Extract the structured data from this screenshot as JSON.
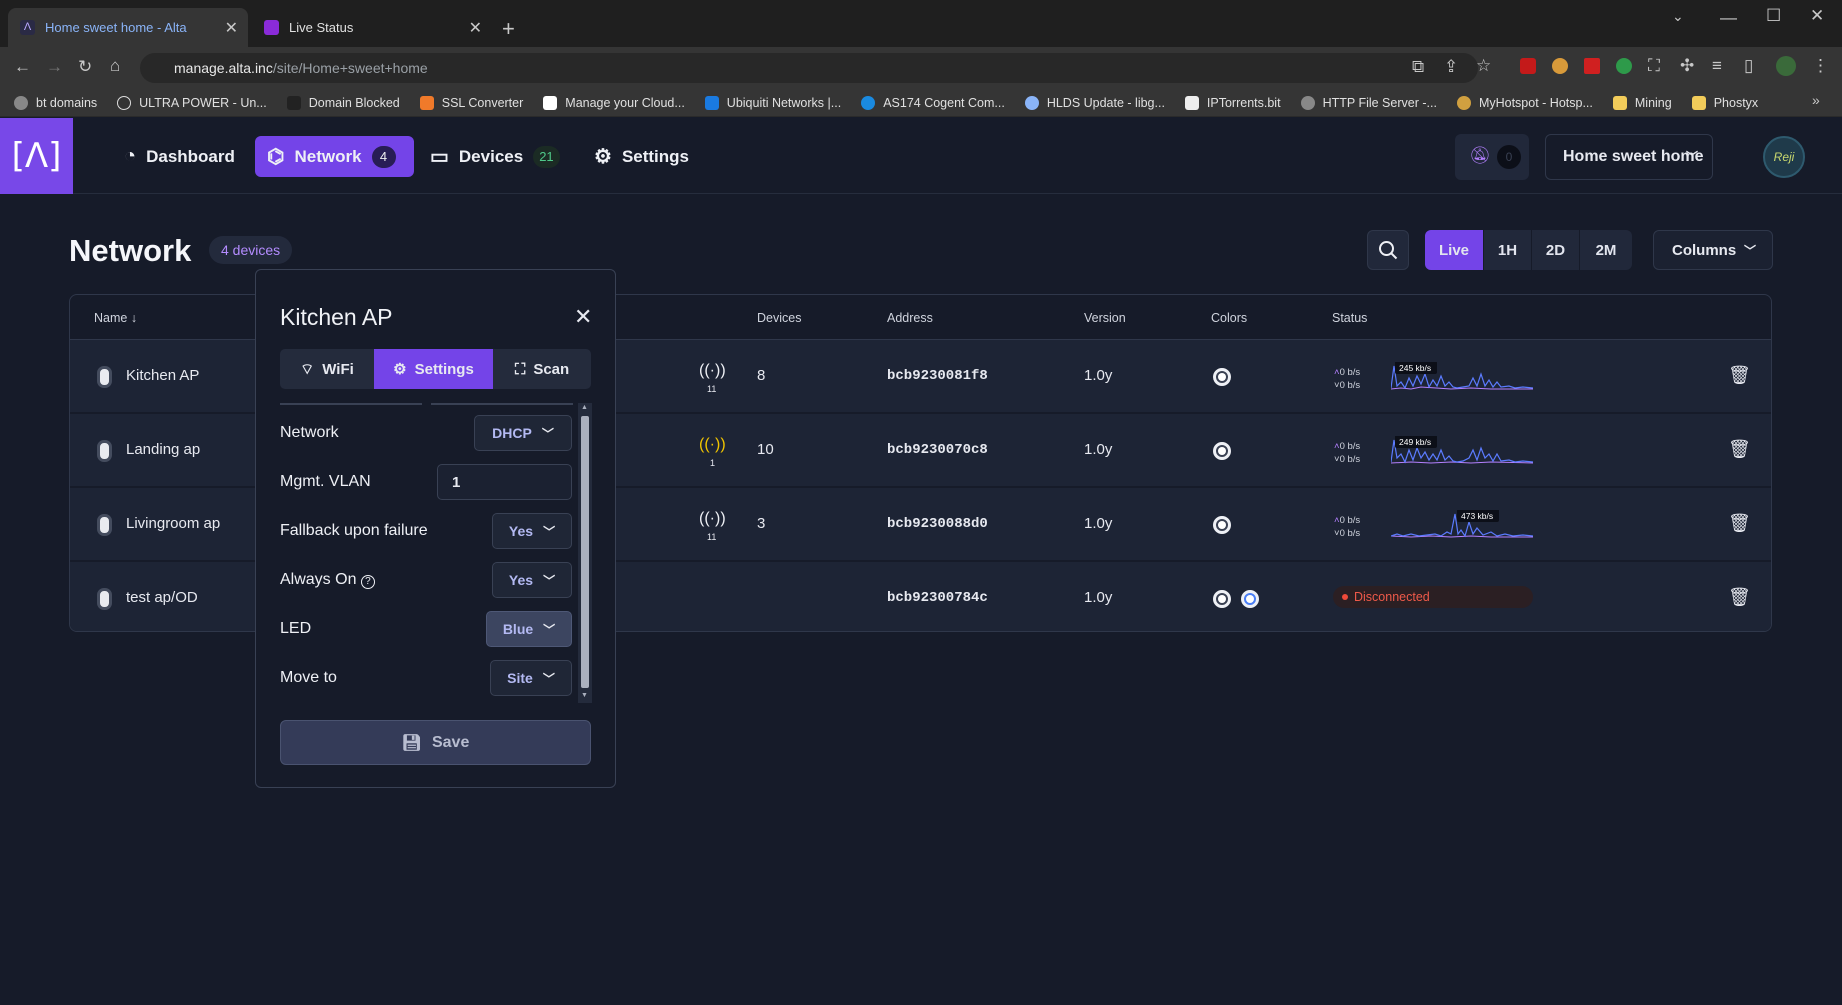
{
  "browser": {
    "tabs": [
      {
        "title": "Home sweet home - Alta",
        "active": true
      },
      {
        "title": "Live Status",
        "active": false
      }
    ],
    "url_host": "manage.alta.inc",
    "url_path": "/site/Home+sweet+home",
    "bookmarks": [
      "bt domains",
      "ULTRA POWER - Un...",
      "Domain Blocked",
      "SSL Converter",
      "Manage your Cloud...",
      "Ubiquiti Networks |...",
      "AS174 Cogent Com...",
      "HLDS Update - libg...",
      "IPTorrents.bit",
      "HTTP File Server -...",
      "MyHotspot - Hotsp...",
      "Mining",
      "Phostyx"
    ]
  },
  "nav": {
    "logo": "[Λ]",
    "dashboard": "Dashboard",
    "network": "Network",
    "network_count": "4",
    "devices": "Devices",
    "devices_count": "21",
    "settings": "Settings",
    "alerts_count": "0",
    "site": "Home sweet home",
    "avatar_text": "Reji"
  },
  "page": {
    "title": "Network",
    "count": "4 devices",
    "ranges": [
      "Live",
      "1H",
      "2D",
      "2M"
    ],
    "columns_label": "Columns"
  },
  "table": {
    "headers": {
      "name": "Name",
      "devices": "Devices",
      "address": "Address",
      "version": "Version",
      "colors": "Colors",
      "status": "Status"
    },
    "rows": [
      {
        "name": "Kitchen AP",
        "clients": "11",
        "devices": "8",
        "address": "bcb9230081f8",
        "version": "1.0y",
        "up": "0 b/s",
        "down": "0 b/s",
        "peak": "245 kb/s"
      },
      {
        "name": "Landing ap",
        "clients": "1",
        "devices": "10",
        "address": "bcb9230070c8",
        "version": "1.0y",
        "up": "0 b/s",
        "down": "0 b/s",
        "peak": "249 kb/s"
      },
      {
        "name": "Livingroom ap",
        "clients": "11",
        "devices": "3",
        "address": "bcb9230088d0",
        "version": "1.0y",
        "up": "0 b/s",
        "down": "0 b/s",
        "peak": "473 kb/s"
      },
      {
        "name": "test ap/OD",
        "clients": "",
        "devices": "",
        "address": "bcb92300784c",
        "version": "1.0y",
        "status": "Disconnected"
      }
    ]
  },
  "popup": {
    "title": "Kitchen AP",
    "tabs": [
      "WiFi",
      "Settings",
      "Scan"
    ],
    "fields": {
      "network_label": "Network",
      "network_value": "DHCP",
      "vlan_label": "Mgmt. VLAN",
      "vlan_value": "1",
      "fallback_label": "Fallback upon failure",
      "fallback_value": "Yes",
      "always_on_label": "Always On",
      "always_on_value": "Yes",
      "led_label": "LED",
      "led_value": "Blue",
      "move_label": "Move to",
      "move_value": "Site"
    },
    "save": "Save"
  },
  "colors": {
    "accent": "#7444e8",
    "background": "#161b29",
    "row": "#1d2435",
    "disconnected": "#ef5a4a"
  }
}
